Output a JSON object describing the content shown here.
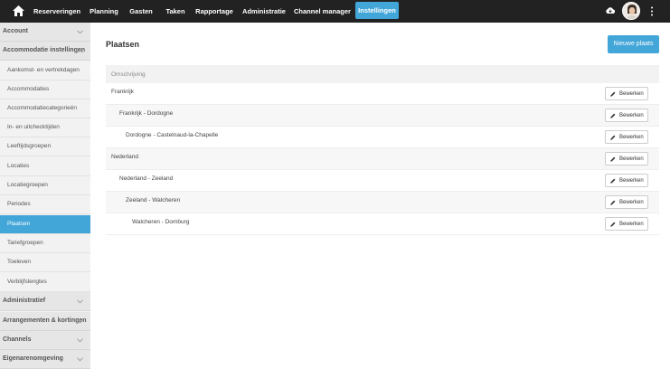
{
  "nav": {
    "home_icon": "home-icon",
    "items": [
      {
        "label": "Reserveringen"
      },
      {
        "label": "Planning"
      },
      {
        "label": "Gasten"
      },
      {
        "label": "Taken"
      },
      {
        "label": "Rapportage"
      },
      {
        "label": "Administratie"
      },
      {
        "label": "Channel manager"
      },
      {
        "label": "Instellingen",
        "active": true
      }
    ],
    "right_icons": [
      "cloud-download-icon",
      "avatar",
      "more-vertical-icon"
    ]
  },
  "sidebar": {
    "sections": [
      {
        "label": "Account",
        "expanded": false
      },
      {
        "label": "Accommodatie instellingen",
        "expanded": true
      },
      {
        "label": "Administratief",
        "expanded": false
      },
      {
        "label": "Arrangementen & kortingen",
        "expanded": false
      },
      {
        "label": "Channels",
        "expanded": false
      },
      {
        "label": "Eigenarenomgeving",
        "expanded": false
      }
    ],
    "items": [
      {
        "label": "Aankomst- en vertrekdagen"
      },
      {
        "label": "Accommodaties"
      },
      {
        "label": "Accommodatiecategorieën"
      },
      {
        "label": "In- en uitchecktijden"
      },
      {
        "label": "Leeftijdsgroepen"
      },
      {
        "label": "Locaties"
      },
      {
        "label": "Locatiegroepen"
      },
      {
        "label": "Periodes"
      },
      {
        "label": "Plaatsen",
        "active": true
      },
      {
        "label": "Tariefgroepen"
      },
      {
        "label": "Toeleven"
      },
      {
        "label": "Verblijfslengtes"
      }
    ]
  },
  "main": {
    "title": "Plaatsen",
    "new_button": "Nieuwe plaats",
    "table": {
      "header": "Omschrijving",
      "edit_label": "Bewerken",
      "rows": [
        {
          "name": "Frankrijk",
          "level": 0
        },
        {
          "name": "Frankrijk - Dordogne",
          "level": 1
        },
        {
          "name": "Dordogne - Castelnaud-la-Chapelle",
          "level": 2
        },
        {
          "name": "Nederland",
          "level": 0
        },
        {
          "name": "Nederland - Zeeland",
          "level": 1
        },
        {
          "name": "Zeeland - Walcheren",
          "level": 2
        },
        {
          "name": "Walcheren - Domburg",
          "level": 3
        }
      ]
    }
  },
  "colors": {
    "topbar": "#222222",
    "accent": "#42a6d8",
    "sidebar_bg": "#f2f2f2",
    "section_bg": "#e6e6e6"
  }
}
